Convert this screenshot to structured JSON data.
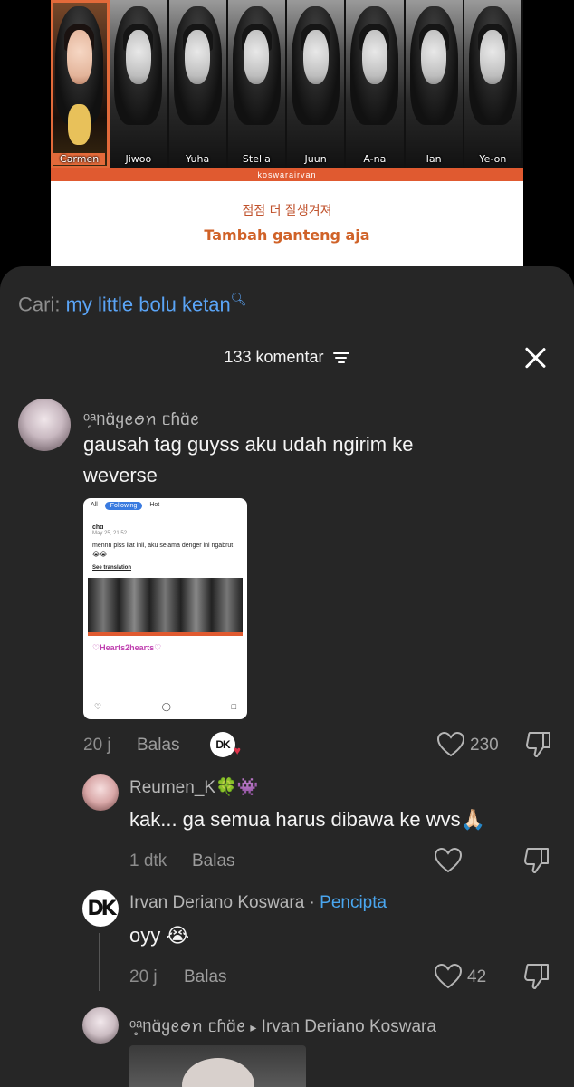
{
  "video": {
    "members": [
      "Carmen",
      "Jiwoo",
      "Yuha",
      "Stella",
      "Juun",
      "A-na",
      "Ian",
      "Ye-on"
    ],
    "credit": "koswarairvan",
    "lyric_korean": "점점 더 잘생겨져",
    "lyric_translation": "Tambah ganteng aja"
  },
  "search": {
    "prefix": "Cari:",
    "query": "my little bolu ketan"
  },
  "sheet": {
    "count_label": "133 komentar"
  },
  "comments": [
    {
      "username": "ᵒ̥ᵃᥒɑ̈ყꫀꪮꪀ ᥴɦɑ̈ꫀ",
      "text": "gausah tag guyss aku udah ngirim ke weverse",
      "time": "20 j",
      "reply_label": "Balas",
      "likes": "230",
      "attachment": {
        "tabs": [
          "All",
          "Following",
          "Hot"
        ],
        "post_user": "chɑ",
        "post_date": "May 25, 21:52",
        "post_body": "mennn plss liat inii, aku selama denger ini ngabrut😭😭",
        "post_link": "See translation",
        "sticker": "♡Hearts2hearts♡"
      }
    },
    {
      "username": "Reumen_K🍀👾",
      "text": "kak... ga semua harus dibawa ke wvs🙏🏻",
      "time": "1 dtk",
      "reply_label": "Balas"
    },
    {
      "username": "Irvan Deriano Koswara",
      "separator": " · ",
      "creator_label": "Pencipta",
      "text": "oyy 😭",
      "time": "20 j",
      "reply_label": "Balas",
      "likes": "42",
      "avatar_text": "DK"
    },
    {
      "username": "ᵒ̥ᵃᥒɑ̈ყꫀꪮꪀ ᥴɦɑ̈ꫀ",
      "reply_arrow": "▸",
      "reply_to": "Irvan Deriano Koswara"
    }
  ],
  "colors": {
    "sheet_bg": "#262626",
    "accent_blue": "#5aa4f6",
    "creator_blue": "#4aa6ef",
    "video_accent": "#e05a30"
  }
}
